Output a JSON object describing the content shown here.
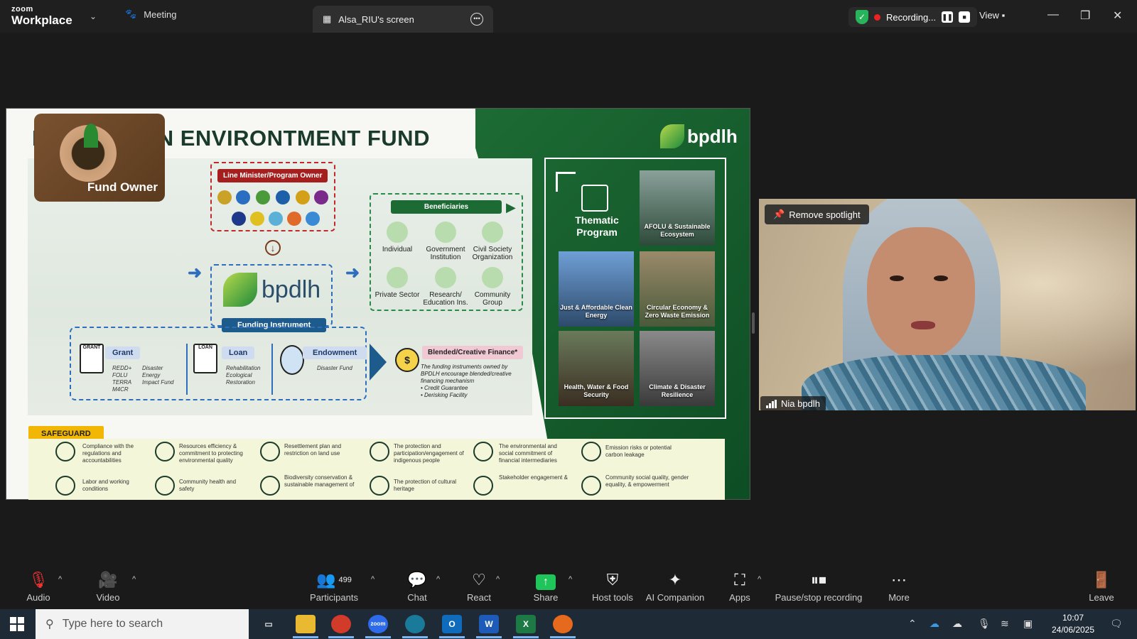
{
  "app": {
    "brand_small": "zoom",
    "brand_large": "Workplace",
    "tabs": [
      {
        "label": "Meeting"
      },
      {
        "label": "Alsa_RIU's screen"
      }
    ],
    "recording_label": "Recording...",
    "view_label": "View"
  },
  "slide": {
    "title": "INDONESIAN ENVIRONTMENT FUND",
    "brand": "bpdlh",
    "fund_owner": "Fund Owner",
    "line_minister": "Line Minister/Program Owner",
    "funding_instrument": "Funding Instrument",
    "instruments": [
      {
        "name": "Grant",
        "icon_text": "GRANT",
        "items_a": [
          "REDD+",
          "FOLU",
          "TERRA",
          "M4CR"
        ],
        "items_b": [
          "Disaster",
          "Energy",
          "Impact Fund"
        ]
      },
      {
        "name": "Loan",
        "icon_text": "LOAN",
        "items_a": [
          "Rehabilitation",
          "Ecological Restoration"
        ]
      },
      {
        "name": "Endowment",
        "items_a": [
          "Disaster Fund"
        ]
      }
    ],
    "beneficiaries_label": "Beneficiaries",
    "beneficiaries": [
      "Individual",
      "Government Institution",
      "Civil Society Organization",
      "Private Sector",
      "Research/ Education Ins.",
      "Community Group"
    ],
    "blended_label": "Blended/Creative Finance*",
    "blended_text": "The funding instruments owned by BPDLH encourage blended/creative financing mechanism",
    "blended_items": [
      "Credit Guarantee",
      "Derisking Facility"
    ],
    "thematic_label": "Thematic Program",
    "thematic_tiles": [
      "AFOLU & Sustainable Ecosystem",
      "Just & Affordable Clean Energy",
      "Circular Economy & Zero Waste Emission",
      "Health, Water & Food Security",
      "Climate & Disaster Resilience"
    ],
    "safeguard_label": "SAFEGUARD",
    "safeguard_items": [
      "Compliance with the regulations and accountabilities",
      "Resources efficiency & commitment to protecting environmental quality",
      "Resettlement plan and restriction on land use",
      "The protection and participation/engagement of indigenous people",
      "The environmental and social commitment of financial intermediaries",
      "Emission risks or potential carbon leakage",
      "Labor and working conditions",
      "Community health and safety",
      "Biodiversity conservation & sustainable management of",
      "The protection of cultural heritage",
      "Stakeholder engagement &",
      "Community social quality, gender equality, & empowerment"
    ]
  },
  "video": {
    "spotlight_button": "Remove spotlight",
    "participant_name": "Nia bpdlh"
  },
  "toolbar": {
    "audio": "Audio",
    "video": "Video",
    "participants": "Participants",
    "participants_count": "499",
    "chat": "Chat",
    "react": "React",
    "share": "Share",
    "host_tools": "Host tools",
    "ai_companion": "AI Companion",
    "apps": "Apps",
    "pause_stop": "Pause/stop recording",
    "more": "More",
    "leave": "Leave"
  },
  "taskbar": {
    "search_placeholder": "Type here to search",
    "time": "10:07",
    "date": "24/06/2025",
    "zoom_label": "zoom"
  },
  "colors": {
    "accent_green": "#1d6b34",
    "recording_red": "#e22222",
    "share_green": "#1fc45a"
  }
}
